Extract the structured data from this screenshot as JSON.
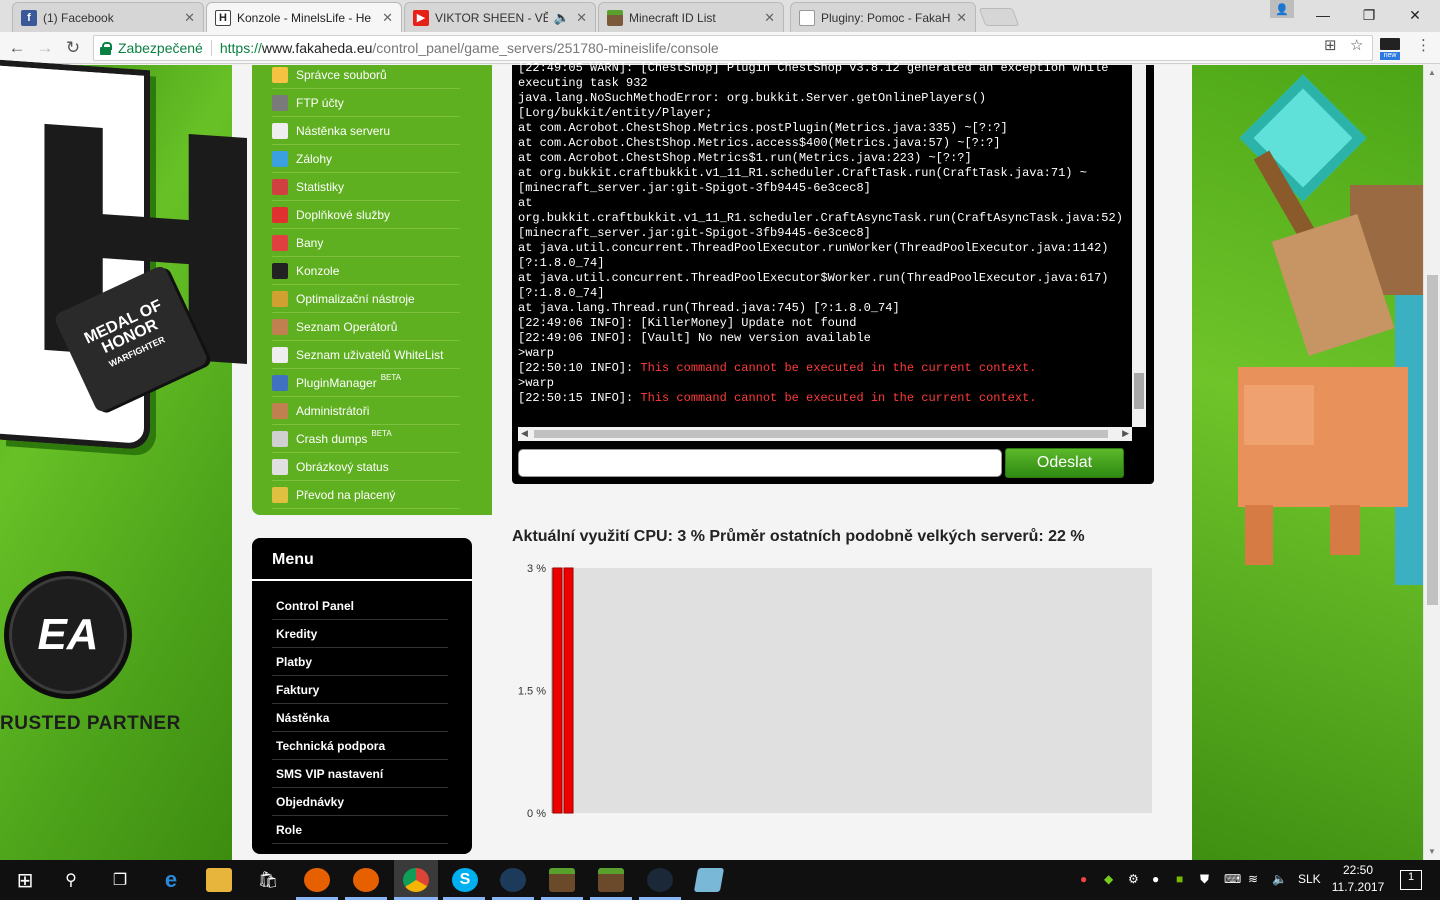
{
  "tabs": [
    {
      "title": "(1) Facebook",
      "icon": "facebook-icon"
    },
    {
      "title": "Konzole - MinelsLife - He",
      "icon": "fakaheda-icon"
    },
    {
      "title": "VIKTOR SHEEN - VĚČ",
      "icon": "youtube-icon"
    },
    {
      "title": "Minecraft ID List",
      "icon": "minecraft-icon"
    },
    {
      "title": "Pluginy: Pomoc - FakaHe",
      "icon": "page-icon"
    }
  ],
  "address": {
    "secure_label": "Zabezpečené",
    "scheme": "https://",
    "host": "www.fakaheda.eu",
    "path": "/control_panel/game_servers/251780-mineislife/console"
  },
  "ext_new": "new",
  "side_menu": [
    {
      "label": "Správce souborů",
      "color": "#f5c242",
      "beta": ""
    },
    {
      "label": "FTP účty",
      "color": "#7a7a7a",
      "beta": ""
    },
    {
      "label": "Nástěnka serveru",
      "color": "#eeeeee",
      "beta": ""
    },
    {
      "label": "Zálohy",
      "color": "#3aa0e0",
      "beta": ""
    },
    {
      "label": "Statistiky",
      "color": "#d04040",
      "beta": ""
    },
    {
      "label": "Doplňkové služby",
      "color": "#e03030",
      "beta": ""
    },
    {
      "label": "Bany",
      "color": "#e04040",
      "beta": ""
    },
    {
      "label": "Konzole",
      "color": "#222222",
      "beta": ""
    },
    {
      "label": "Optimalizační nástroje",
      "color": "#d0a030",
      "beta": ""
    },
    {
      "label": "Seznam Operátorů",
      "color": "#c08050",
      "beta": ""
    },
    {
      "label": "Seznam uživatelů WhiteList",
      "color": "#eeeeee",
      "beta": ""
    },
    {
      "label": "PluginManager",
      "color": "#4070c0",
      "beta": "BETA"
    },
    {
      "label": "Administrátoři",
      "color": "#c08050",
      "beta": ""
    },
    {
      "label": "Crash dumps",
      "color": "#d0d0d0",
      "beta": "BETA"
    },
    {
      "label": "Obrázkový status",
      "color": "#e0e0e0",
      "beta": ""
    },
    {
      "label": "Převod na placený",
      "color": "#e0c040",
      "beta": ""
    }
  ],
  "menu": {
    "title": "Menu",
    "items": [
      "Control Panel",
      "Kredity",
      "Platby",
      "Faktury",
      "Nástěnka",
      "Technická podpora",
      "SMS VIP nastavení",
      "Objednávky",
      "Role"
    ]
  },
  "console": {
    "lines": [
      {
        "text": "[22:49:05 WARN]: [ChestShop] Plugin ChestShop v3.8.12 generated an exception while",
        "err": false
      },
      {
        "text": "executing task 932",
        "err": false
      },
      {
        "text": "java.lang.NoSuchMethodError: org.bukkit.Server.getOnlinePlayers()",
        "err": false
      },
      {
        "text": "[Lorg/bukkit/entity/Player;",
        "err": false
      },
      {
        "text": "at com.Acrobot.ChestShop.Metrics.postPlugin(Metrics.java:335) ~[?:?]",
        "err": false
      },
      {
        "text": "at com.Acrobot.ChestShop.Metrics.access$400(Metrics.java:57) ~[?:?]",
        "err": false
      },
      {
        "text": "at com.Acrobot.ChestShop.Metrics$1.run(Metrics.java:223) ~[?:?]",
        "err": false
      },
      {
        "text": "at org.bukkit.craftbukkit.v1_11_R1.scheduler.CraftTask.run(CraftTask.java:71) ~",
        "err": false
      },
      {
        "text": "[minecraft_server.jar:git-Spigot-3fb9445-6e3cec8]",
        "err": false
      },
      {
        "text": "at",
        "err": false
      },
      {
        "text": "org.bukkit.craftbukkit.v1_11_R1.scheduler.CraftAsyncTask.run(CraftAsyncTask.java:52)",
        "err": false
      },
      {
        "text": "[minecraft_server.jar:git-Spigot-3fb9445-6e3cec8]",
        "err": false
      },
      {
        "text": "at java.util.concurrent.ThreadPoolExecutor.runWorker(ThreadPoolExecutor.java:1142)",
        "err": false
      },
      {
        "text": "[?:1.8.0_74]",
        "err": false
      },
      {
        "text": "at java.util.concurrent.ThreadPoolExecutor$Worker.run(ThreadPoolExecutor.java:617)",
        "err": false
      },
      {
        "text": "[?:1.8.0_74]",
        "err": false
      },
      {
        "text": "at java.lang.Thread.run(Thread.java:745) [?:1.8.0_74]",
        "err": false
      },
      {
        "text": "[22:49:06 INFO]: [KillerMoney] Update not found",
        "err": false
      },
      {
        "text": "[22:49:06 INFO]: [Vault] No new version available",
        "err": false
      },
      {
        "text": ">warp",
        "err": false
      },
      {
        "text": "[22:50:10 INFO]: ",
        "err_text": "This command cannot be executed in the current context.",
        "err": true
      },
      {
        "text": ">warp",
        "err": false
      },
      {
        "text": "[22:50:15 INFO]: ",
        "err_text": "This command cannot be executed in the current context.",
        "err": true
      }
    ],
    "input_value": "",
    "send_label": "Odeslat"
  },
  "cpu": {
    "title": "Aktuální využití CPU: 3 % Průměr ostatních podobně velkých serverů: 22 %"
  },
  "chart_data": {
    "type": "bar",
    "title": "",
    "xlabel": "",
    "ylabel": "",
    "y_ticks": [
      "3 %",
      "1.5 %",
      "0 %"
    ],
    "ylim": [
      0,
      3
    ],
    "values": [
      3,
      3
    ],
    "bar_color": "#ee0000",
    "background": "#e0e0e0"
  },
  "decor": {
    "moh_line1": "MEDAL OF",
    "moh_line2": "HONOR",
    "moh_line3": "WARFIGHTER",
    "ea": "EA",
    "partner": "RUSTED PARTNER"
  },
  "taskbar": {
    "lang": "SLK",
    "time": "22:50",
    "date": "11.7.2017",
    "notif_count": "1"
  }
}
